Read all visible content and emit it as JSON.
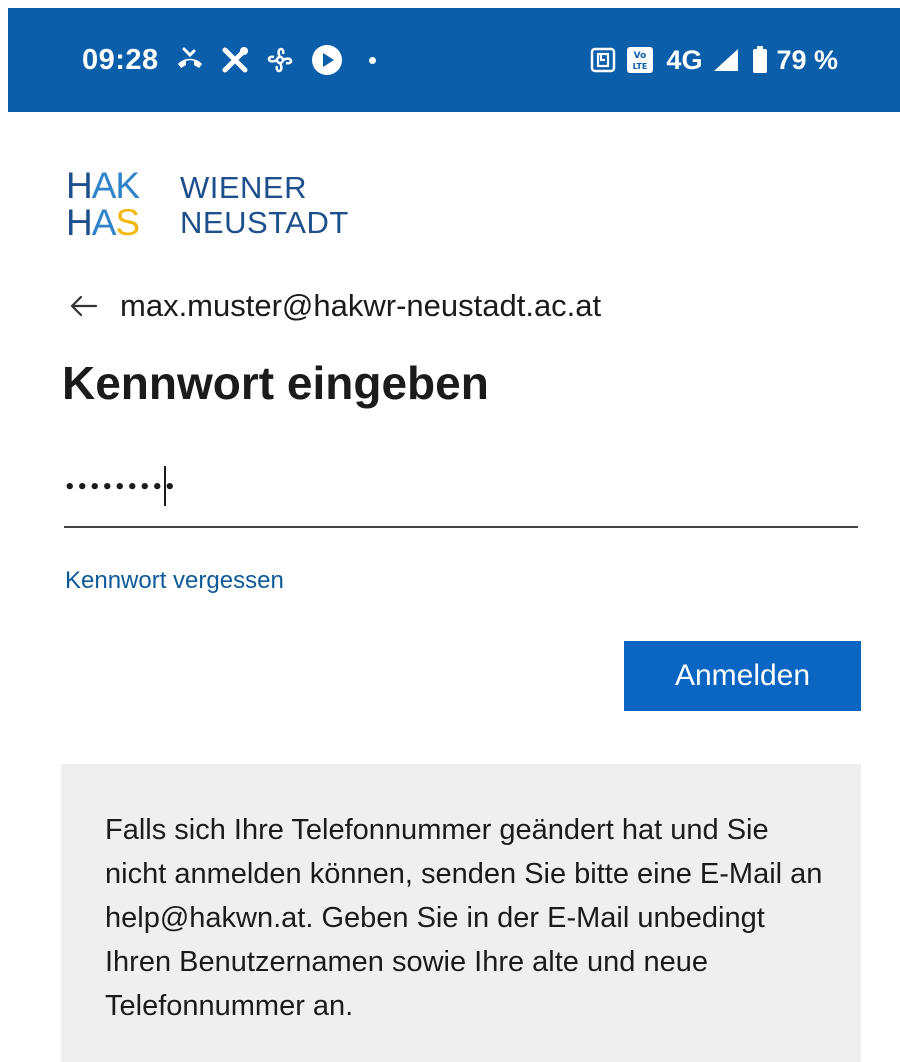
{
  "status_bar": {
    "time": "09:28",
    "left_icons": [
      "missed-call-icon",
      "tools-icon",
      "fan-icon",
      "play-icon",
      "dot-icon"
    ],
    "right_icons": [
      "nfc-icon",
      "volte-icon",
      "signal-icon",
      "battery-icon"
    ],
    "network": "4G",
    "battery": "79 %",
    "volte_label": "Vo LTE",
    "background": "#0a5eaa"
  },
  "logo": {
    "mark_row1": "HAK",
    "mark_row2": "HAS",
    "name_line1": "WIENER",
    "name_line2": "NEUSTADT",
    "colors": {
      "dark_blue": "#1d4f8c",
      "light_blue": "#2f83c9",
      "yellow": "#f2b80f"
    }
  },
  "account": {
    "back_icon": "arrow-left-icon",
    "email": "max.muster@hakwr-neustadt.ac.at"
  },
  "page": {
    "title": "Kennwort eingeben"
  },
  "password": {
    "value": "•••••••••"
  },
  "links": {
    "forgot": "Kennwort vergessen"
  },
  "actions": {
    "sign_in": "Anmelden",
    "accent": "#0a66c2"
  },
  "info": {
    "text": "Falls sich Ihre Telefonnummer geändert hat und Sie nicht anmelden können, senden Sie bitte eine E-Mail an help@hakwn.at. Geben Sie in der E-Mail unbedingt Ihren Benutzernamen sowie Ihre alte und neue Telefonnummer an."
  }
}
